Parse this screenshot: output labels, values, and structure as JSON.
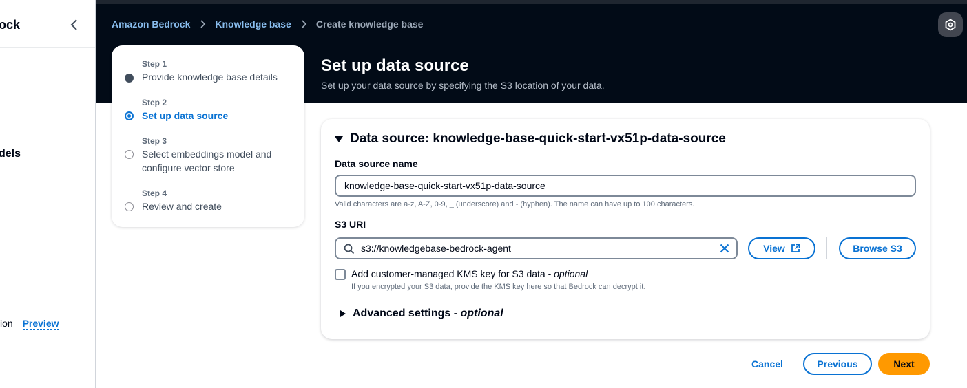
{
  "sidebar": {
    "title_fragment": "ock",
    "models_fragment": "dels",
    "preview_fragment": "ion",
    "preview_label": "Preview"
  },
  "breadcrumb": {
    "items": [
      "Amazon Bedrock",
      "Knowledge base"
    ],
    "current": "Create knowledge base"
  },
  "header": {
    "title": "Set up data source",
    "description": "Set up your data source by specifying the S3 location of your data."
  },
  "steps": [
    {
      "number": "Step 1",
      "label": "Provide knowledge base details",
      "state": "completed"
    },
    {
      "number": "Step 2",
      "label": "Set up data source",
      "state": "active"
    },
    {
      "number": "Step 3",
      "label_line1": "Select embeddings model and",
      "label_line2": "configure vector store",
      "state": "pending"
    },
    {
      "number": "Step 4",
      "label": "Review and create",
      "state": "pending"
    }
  ],
  "data_source": {
    "header": "Data source: knowledge-base-quick-start-vx51p-data-source",
    "name_label": "Data source name",
    "name_value": "knowledge-base-quick-start-vx51p-data-source",
    "name_hint": "Valid characters are a-z, A-Z, 0-9, _ (underscore) and - (hyphen). The name can have up to 100 characters.",
    "s3_label": "S3 URI",
    "s3_value": "s3://knowledgebase-bedrock-agent",
    "view_label": "View",
    "browse_label": "Browse S3",
    "kms_label": "Add customer-managed KMS key for S3 data - ",
    "kms_optional": "optional",
    "kms_description": "If you encrypted your S3 data, provide the KMS key here so that Bedrock can decrypt it.",
    "kms_checked": false,
    "advanced_label": "Advanced settings - ",
    "advanced_optional": "optional"
  },
  "footer": {
    "cancel": "Cancel",
    "previous": "Previous",
    "next": "Next"
  },
  "colors": {
    "link": "#0972d3",
    "primary_button": "#ff9900",
    "header_bg": "#020b17"
  }
}
